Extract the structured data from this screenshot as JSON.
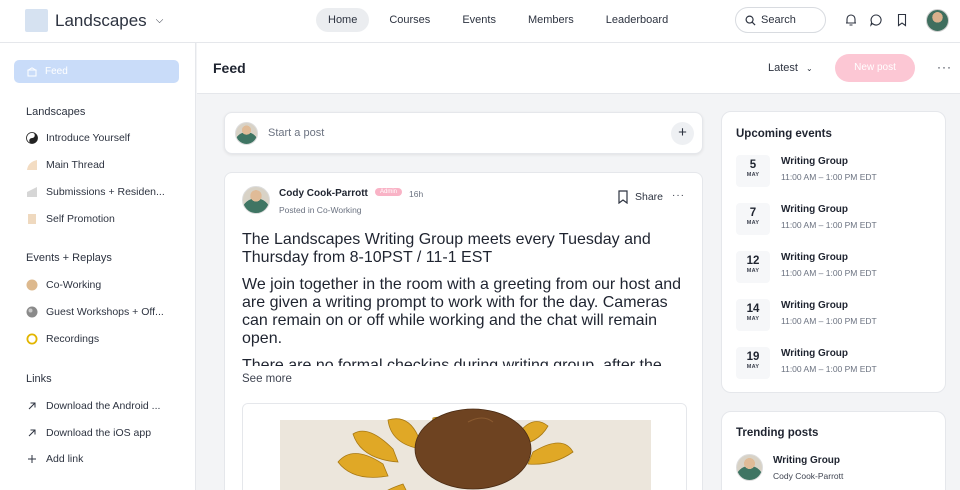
{
  "app": {
    "brand": "Landscapes",
    "nav": [
      "Home",
      "Courses",
      "Events",
      "Members",
      "Leaderboard"
    ],
    "search_placeholder": "Search"
  },
  "sidebar": {
    "feed_label": "Feed",
    "sections": [
      {
        "title": "Landscapes",
        "items": [
          {
            "label": "Introduce Yourself",
            "icon": "yin-yang-icon"
          },
          {
            "label": "Main Thread",
            "icon": "paper-icon"
          },
          {
            "label": "Submissions + Residen...",
            "icon": "layers-icon"
          },
          {
            "label": "Self Promotion",
            "icon": "note-icon"
          }
        ]
      },
      {
        "title": "Events + Replays",
        "items": [
          {
            "label": "Co-Working",
            "icon": "circle-icon"
          },
          {
            "label": "Guest Workshops + Off...",
            "icon": "globe-icon"
          },
          {
            "label": "Recordings",
            "icon": "ring-icon"
          }
        ]
      },
      {
        "title": "Links",
        "items": [
          {
            "label": "Download the Android ...",
            "icon": "arrow-up-right-icon"
          },
          {
            "label": "Download the iOS app",
            "icon": "arrow-up-right-icon"
          },
          {
            "label": "Add link",
            "icon": "plus-icon"
          }
        ]
      }
    ]
  },
  "feed": {
    "title": "Feed",
    "sort_label": "Latest",
    "new_post_label": "New post",
    "composer_placeholder": "Start a post"
  },
  "post": {
    "author": "Cody Cook-Parrott",
    "badge": "Admin",
    "timestamp": "16h",
    "posted_in": "Posted in Co-Working",
    "share_label": "Share",
    "paragraphs": [
      "The Landscapes Writing Group meets every Tuesday and Thursday from 8-10PST / 11-1 EST",
      "We join together in the room with a greeting from our host and are given a writing prompt to work with for the day. Cameras can remain on or off while working and the chat will remain open.",
      "There are no formal checkins during writing group, after the prompt we get right to work. For questions, desires, and reports join the monthly office hours on the last"
    ],
    "see_more": "See more"
  },
  "upcoming": {
    "title": "Upcoming events",
    "events": [
      {
        "day": "5",
        "month": "MAY",
        "name": "Writing Group",
        "time": "11:00 AM – 1:00 PM EDT"
      },
      {
        "day": "7",
        "month": "MAY",
        "name": "Writing Group",
        "time": "11:00 AM – 1:00 PM EDT"
      },
      {
        "day": "12",
        "month": "MAY",
        "name": "Writing Group",
        "time": "11:00 AM – 1:00 PM EDT"
      },
      {
        "day": "14",
        "month": "MAY",
        "name": "Writing Group",
        "time": "11:00 AM – 1:00 PM EDT"
      },
      {
        "day": "19",
        "month": "MAY",
        "name": "Writing Group",
        "time": "11:00 AM – 1:00 PM EDT"
      }
    ]
  },
  "trending": {
    "title": "Trending posts",
    "items": [
      {
        "title": "Writing Group",
        "author": "Cody Cook-Parrott"
      }
    ]
  },
  "colors": {
    "accent_pink": "#fcc7d4",
    "accent_blue": "#c9dcf9"
  }
}
